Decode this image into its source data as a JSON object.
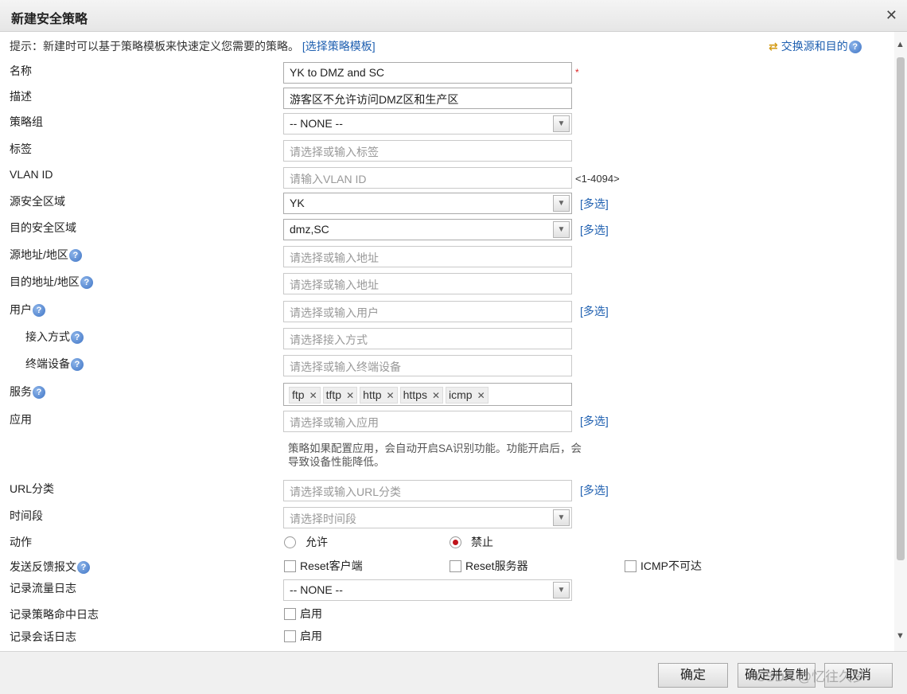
{
  "dialog": {
    "title": "新建安全策略",
    "close_icon": "close-icon"
  },
  "hint": {
    "text": "提示：新建时可以基于策略模板来快速定义您需要的策略。",
    "link": "[选择策略模板]"
  },
  "swap": {
    "label": "交换源和目的"
  },
  "help_glyph": "?",
  "required_mark": "*",
  "multi_label": "[多选]",
  "form": {
    "name": {
      "label": "名称",
      "value": "YK to DMZ and SC"
    },
    "description": {
      "label": "描述",
      "value": "游客区不允许访问DMZ区和生产区"
    },
    "policy_group": {
      "label": "策略组",
      "value": "-- NONE --"
    },
    "tag": {
      "label": "标签",
      "placeholder": "请选择或输入标签"
    },
    "vlan_id": {
      "label": "VLAN ID",
      "placeholder": "请输入VLAN ID",
      "range": "<1-4094>"
    },
    "src_zone": {
      "label": "源安全区域",
      "value": "YK"
    },
    "dst_zone": {
      "label": "目的安全区域",
      "value": "dmz,SC"
    },
    "src_addr": {
      "label": "源地址/地区",
      "placeholder": "请选择或输入地址"
    },
    "dst_addr": {
      "label": "目的地址/地区",
      "placeholder": "请选择或输入地址"
    },
    "user": {
      "label": "用户",
      "placeholder": "请选择或输入用户"
    },
    "access_mode": {
      "label": "接入方式",
      "placeholder": "请选择接入方式"
    },
    "terminal": {
      "label": "终端设备",
      "placeholder": "请选择或输入终端设备"
    },
    "service": {
      "label": "服务",
      "tags": [
        "ftp",
        "tftp",
        "http",
        "https",
        "icmp"
      ],
      "remove_glyph": "✕"
    },
    "app": {
      "label": "应用",
      "placeholder": "请选择或输入应用",
      "note": "策略如果配置应用，会自动开启SA识别功能。功能开启后，会导致设备性能降低。"
    },
    "url": {
      "label": "URL分类",
      "placeholder": "请选择或输入URL分类"
    },
    "time": {
      "label": "时间段",
      "placeholder": "请选择时间段"
    },
    "action": {
      "label": "动作",
      "allow": "允许",
      "deny": "禁止",
      "selected": "禁止"
    },
    "feedback": {
      "label": "发送反馈报文",
      "reset_client": "Reset客户端",
      "reset_server": "Reset服务器",
      "icmp_unreach": "ICMP不可达"
    },
    "traffic_log": {
      "label": "记录流量日志",
      "value": "-- NONE --"
    },
    "hit_log": {
      "label": "记录策略命中日志",
      "enable": "启用"
    },
    "session_log": {
      "label": "记录会话日志",
      "enable": "启用"
    }
  },
  "buttons": {
    "ok": "确定",
    "ok_copy": "确定并复制",
    "cancel": "取消"
  },
  "watermark": "CSDN @忆往久梦"
}
